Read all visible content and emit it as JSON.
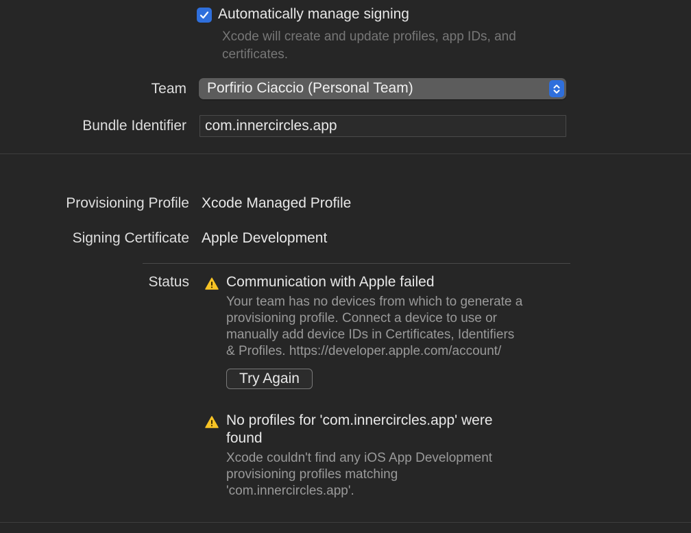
{
  "signing": {
    "auto_manage_label": "Automatically manage signing",
    "auto_manage_checked": true,
    "auto_manage_help": "Xcode will create and update profiles, app IDs, and certificates."
  },
  "team": {
    "label": "Team",
    "value": "Porfirio Ciaccio (Personal Team)"
  },
  "bundle": {
    "label": "Bundle Identifier",
    "value": "com.innercircles.app"
  },
  "provisioning": {
    "label": "Provisioning Profile",
    "value": "Xcode Managed Profile"
  },
  "certificate": {
    "label": "Signing Certificate",
    "value": "Apple Development"
  },
  "status": {
    "label": "Status",
    "messages": [
      {
        "icon": "warning-icon",
        "title": "Communication with Apple failed",
        "body_lines": [
          "Your team has no devices from which to generate a",
          "provisioning profile. Connect a device to use or",
          "manually add device IDs in Certificates, Identifiers",
          "& Profiles. https://developer.apple.com/account/"
        ],
        "action_label": "Try Again"
      },
      {
        "icon": "warning-icon",
        "title_lines": [
          "No profiles for 'com.innercircles.app' were",
          "found"
        ],
        "body_lines": [
          "Xcode couldn't find any iOS App Development",
          "provisioning profiles matching",
          "'com.innercircles.app'."
        ]
      }
    ]
  },
  "colors": {
    "background": "#262626",
    "accent": "#2f6fdc",
    "warning": "#f7c325"
  }
}
